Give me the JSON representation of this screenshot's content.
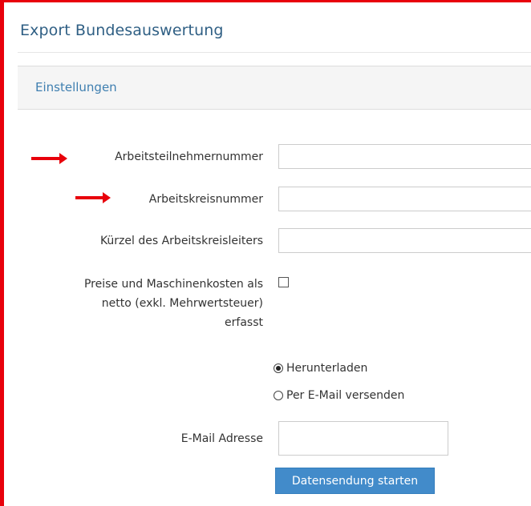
{
  "page": {
    "title": "Export Bundesauswertung"
  },
  "panel": {
    "title": "Einstellungen"
  },
  "form": {
    "fields": [
      {
        "label": "Arbeitsteilnehmernummer",
        "value": ""
      },
      {
        "label": "Arbeitskreisnummer",
        "value": ""
      },
      {
        "label": "Kürzel des Arbeitskreisleiters",
        "value": ""
      }
    ],
    "checkbox": {
      "label_lines": [
        "Preise und Maschinenkosten als",
        "netto (exkl. Mehrwertsteuer)",
        "erfasst"
      ],
      "checked": false
    },
    "delivery": {
      "options": [
        {
          "label": "Herunterladen",
          "selected": true
        },
        {
          "label": "Per E-Mail versenden",
          "selected": false
        }
      ]
    },
    "email": {
      "label": "E-Mail Adresse",
      "value": ""
    },
    "submit_label": "Datensendung starten"
  },
  "annotations": {
    "arrow_color": "#e8000b",
    "frame_color": "#e8000b"
  },
  "colors": {
    "title": "#2f5f84",
    "panel_title": "#3f7fb0",
    "button": "#428bca"
  }
}
